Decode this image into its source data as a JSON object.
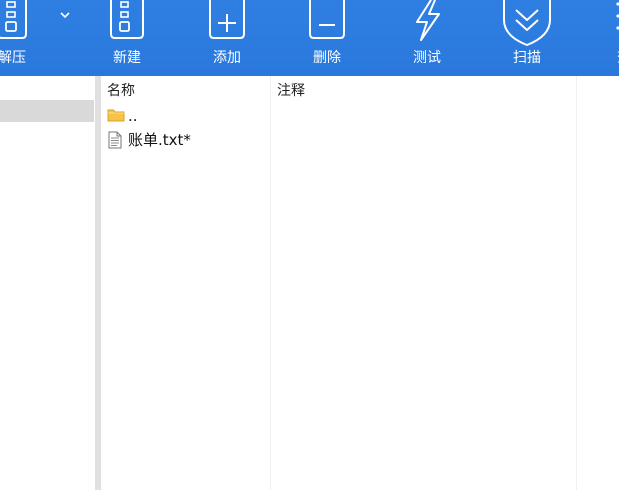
{
  "toolbar": {
    "extract_label": "解压",
    "new_label": "新建",
    "add_label": "添加",
    "delete_label": "删除",
    "test_label": "测试",
    "scan_label": "扫描",
    "view_label": "查",
    "background": "#2a78dc",
    "text_color": "#ffffff"
  },
  "file_list": {
    "columns": {
      "name": "名称",
      "comment": "注释"
    },
    "rows": [
      {
        "name": "..",
        "icon": "folder-icon"
      },
      {
        "name": "账单.txt*",
        "icon": "text-file-icon"
      }
    ]
  },
  "colors": {
    "folder": "#f6c344",
    "selection": "#d9d9d9"
  }
}
